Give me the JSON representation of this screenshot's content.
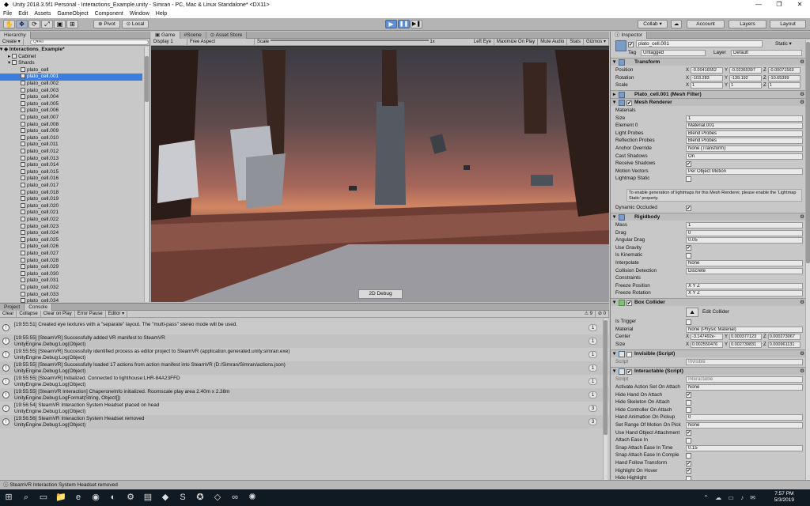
{
  "window": {
    "title": "Unity 2018.3.5f1 Personal - Interactions_Example.unity - Simran - PC, Mac & Linux Standalone* <DX11>"
  },
  "menu": [
    "File",
    "Edit",
    "Assets",
    "GameObject",
    "Component",
    "Window",
    "Help"
  ],
  "toolbar": {
    "pivot": "Pivot",
    "local": "Local",
    "collab": "Collab ▾",
    "account": "Account",
    "layers": "Layers",
    "layout": "Layout"
  },
  "hierarchy": {
    "tab": "Hierarchy",
    "create": "Create ▾",
    "search_placeholder": "Q▾All",
    "scene": "Interactions_Example*",
    "cabinet": "Cabinet",
    "shards": "Shards",
    "items": [
      "plato_cell",
      "plato_cell.001",
      "plato_cell.002",
      "plato_cell.003",
      "plato_cell.004",
      "plato_cell.005",
      "plato_cell.006",
      "plato_cell.007",
      "plato_cell.008",
      "plato_cell.009",
      "plato_cell.010",
      "plato_cell.011",
      "plato_cell.012",
      "plato_cell.013",
      "plato_cell.014",
      "plato_cell.015",
      "plato_cell.016",
      "plato_cell.017",
      "plato_cell.018",
      "plato_cell.019",
      "plato_cell.020",
      "plato_cell.021",
      "plato_cell.022",
      "plato_cell.023",
      "plato_cell.024",
      "plato_cell.025",
      "plato_cell.026",
      "plato_cell.027",
      "plato_cell.028",
      "plato_cell.029",
      "plato_cell.030",
      "plato_cell.031",
      "plato_cell.032",
      "plato_cell.033",
      "plato_cell.034"
    ],
    "selected_index": 1
  },
  "game": {
    "tabs": [
      "Game",
      "Scene",
      "Asset Store"
    ],
    "display": "Display 1",
    "aspect": "Free Aspect",
    "scale_label": "Scale",
    "scale_value": "1x",
    "eye": "Left Eye",
    "maximize": "Maximize On Play",
    "mute": "Mute Audio",
    "stats": "Stats",
    "gizmos": "Gizmos ▾",
    "debug_button": "2D Debug"
  },
  "console": {
    "tabs": [
      "Project",
      "Console"
    ],
    "buttons": [
      "Clear",
      "Collapse",
      "Clear on Play",
      "Error Pause",
      "Editor ▾"
    ],
    "counts": {
      "warn": "9",
      "err": "0"
    },
    "entries": [
      {
        "l1": "[19:55:51] Created eye textures with a \"separate\" layout.  The \"multi-pass\" stereo mode will be used.",
        "l2": "",
        "count": "1"
      },
      {
        "l1": "[19:55:55] [SteamVR] Successfully added VR manifest to SteamVR",
        "l2": "UnityEngine.Debug:Log(Object)",
        "count": "1"
      },
      {
        "l1": "[19:55:55] [SteamVR] Successfully identified process as editor project to SteamVR (application.generated.unity.simran.exe)",
        "l2": "UnityEngine.Debug:Log(Object)",
        "count": "1"
      },
      {
        "l1": "[19:55:55] [SteamVR] Successfully loaded 17 actions from action manifest into SteamVR (D:/Simran/Simran/actions.json)",
        "l2": "UnityEngine.Debug:Log(Object)",
        "count": "1"
      },
      {
        "l1": "[19:55:55] [SteamVR] Initialized. Connected to lighthouse:LHR-84A23FFD",
        "l2": "UnityEngine.Debug:Log(Object)",
        "count": "1"
      },
      {
        "l1": "[19:55:55] [SteamVR Interaction] ChaperoneInfo initialized. Roomscale play area 2.40m x 2.38m",
        "l2": "UnityEngine.Debug:LogFormat(String, Object[])",
        "count": "1"
      },
      {
        "l1": "[19:56:54] SteamVR Interaction System Headset placed on head",
        "l2": "UnityEngine.Debug:Log(Object)",
        "count": "3"
      },
      {
        "l1": "[19:56:56] SteamVR Interaction System Headset removed",
        "l2": "UnityEngine.Debug:Log(Object)",
        "count": "3"
      }
    ]
  },
  "status": "SteamVR Interaction System Headset removed",
  "inspector": {
    "tab": "Inspector",
    "name": "plato_cell.001",
    "static": "Static ▾",
    "tag_label": "Tag",
    "tag": "Untagged",
    "layer_label": "Layer",
    "layer": "Default",
    "transform": {
      "title": "Transform",
      "position": [
        "-0.00416552",
        "-0.02369397",
        "-0.00071563"
      ],
      "rotation": [
        "-103.283",
        "-139.192",
        "-10.65399"
      ],
      "scale": [
        "1",
        "1",
        "1"
      ]
    },
    "mesh_filter": "Plato_cell.001 (Mesh Filter)",
    "mesh_renderer": {
      "title": "Mesh Renderer",
      "rows": [
        [
          "Materials",
          ""
        ],
        [
          "Size",
          "1"
        ],
        [
          "Element 0",
          "Material.001"
        ],
        [
          "Light Probes",
          "Blend Probes"
        ],
        [
          "Reflection Probes",
          "Blend Probes"
        ],
        [
          "Anchor Override",
          "None (Transform)"
        ],
        [
          "Cast Shadows",
          "On"
        ],
        [
          "Receive Shadows",
          "✔"
        ],
        [
          "Motion Vectors",
          "Per Object Motion"
        ],
        [
          "Lightmap Static",
          ""
        ]
      ],
      "note": "To enable generation of lightmaps for this Mesh Renderer, please enable the 'Lightmap Static' property.",
      "dyn": "Dynamic Occluded"
    },
    "rigidbody": {
      "title": "Rigidbody",
      "rows": [
        [
          "Mass",
          "1"
        ],
        [
          "Drag",
          "0"
        ],
        [
          "Angular Drag",
          "0.05"
        ],
        [
          "Use Gravity",
          "✔"
        ],
        [
          "Is Kinematic",
          ""
        ],
        [
          "Interpolate",
          "None"
        ],
        [
          "Collision Detection",
          "Discrete"
        ],
        [
          "Constraints",
          ""
        ],
        [
          "Freeze Position",
          "X  Y  Z"
        ],
        [
          "Freeze Rotation",
          "X  Y  Z"
        ]
      ]
    },
    "box_collider": {
      "title": "Box Collider",
      "edit": "Edit Collider",
      "is_trigger": "Is Trigger",
      "material_label": "Material",
      "material": "None (Physic Material)",
      "center": [
        "-3.147492e-",
        "0.000377123",
        "0.000273067"
      ],
      "size": [
        "0.002550476",
        "0.002739831",
        "0.000961131"
      ],
      "center_label": "Center",
      "size_label": "Size"
    },
    "invisible": {
      "title": "Invisible (Script)",
      "script_label": "Script",
      "script": "Invisible"
    },
    "interactable": {
      "title": "Interactable (Script)",
      "script_label": "Script",
      "script": "Interactable",
      "rows": [
        [
          "Activate Action Set On Attach",
          "None"
        ],
        [
          "Hide Hand On Attach",
          "✔"
        ],
        [
          "Hide Skeleton On Attach",
          ""
        ],
        [
          "Hide Controller On Attach",
          ""
        ],
        [
          "Hand Animation On Pickup",
          "0"
        ],
        [
          "Set Range Of Motion On Pick",
          "None"
        ],
        [
          "Use Hand Object Attachment",
          "✔"
        ],
        [
          "Attach Ease In",
          ""
        ],
        [
          "Snap Attach Ease In Time",
          "0.15"
        ],
        [
          "Snap Attach Ease In Comple",
          ""
        ],
        [
          "Hand Follow Transform",
          "✔"
        ],
        [
          "Highlight On Hover",
          "✔"
        ],
        [
          "Hide Highlight",
          ""
        ]
      ]
    }
  },
  "taskbar": {
    "time": "7:57 PM",
    "date": "5/3/2019"
  }
}
